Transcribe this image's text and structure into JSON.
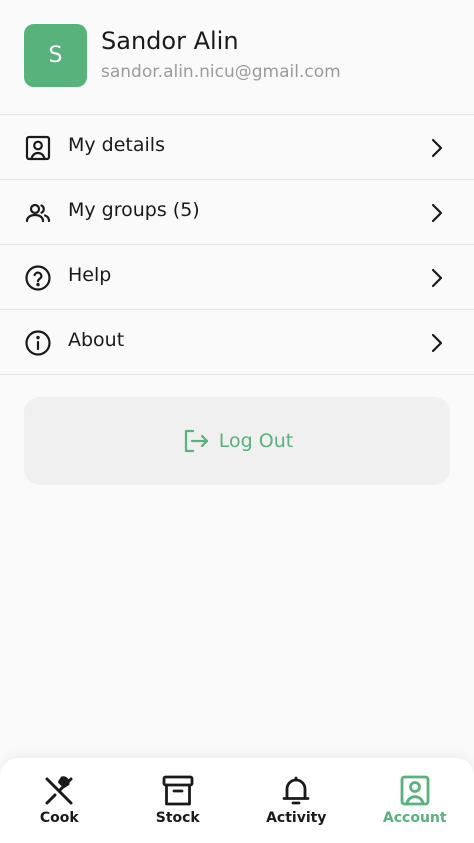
{
  "profile": {
    "initial": "S",
    "name": "Sandor Alin",
    "email": "sandor.alin.nicu@gmail.com"
  },
  "menu": {
    "items": [
      {
        "label": "My details",
        "icon": "user-card-icon"
      },
      {
        "label": "My groups (5)",
        "icon": "users-icon"
      },
      {
        "label": "Help",
        "icon": "help-circle-icon"
      },
      {
        "label": "About",
        "icon": "info-circle-icon"
      }
    ]
  },
  "logout": {
    "label": "Log Out",
    "icon": "logout-icon"
  },
  "bottom_nav": {
    "items": [
      {
        "label": "Cook",
        "icon": "utensils-icon"
      },
      {
        "label": "Stock",
        "icon": "archive-box-icon"
      },
      {
        "label": "Activity",
        "icon": "bell-icon"
      },
      {
        "label": "Account",
        "icon": "user-card-icon"
      }
    ],
    "active": "Account"
  },
  "colors": {
    "accent": "#57b27b",
    "text": "#1a1a1a",
    "muted": "#9b9b9b",
    "divider": "#e4e4e4",
    "background": "#fafafa",
    "button_bg": "#f0f0f0"
  }
}
